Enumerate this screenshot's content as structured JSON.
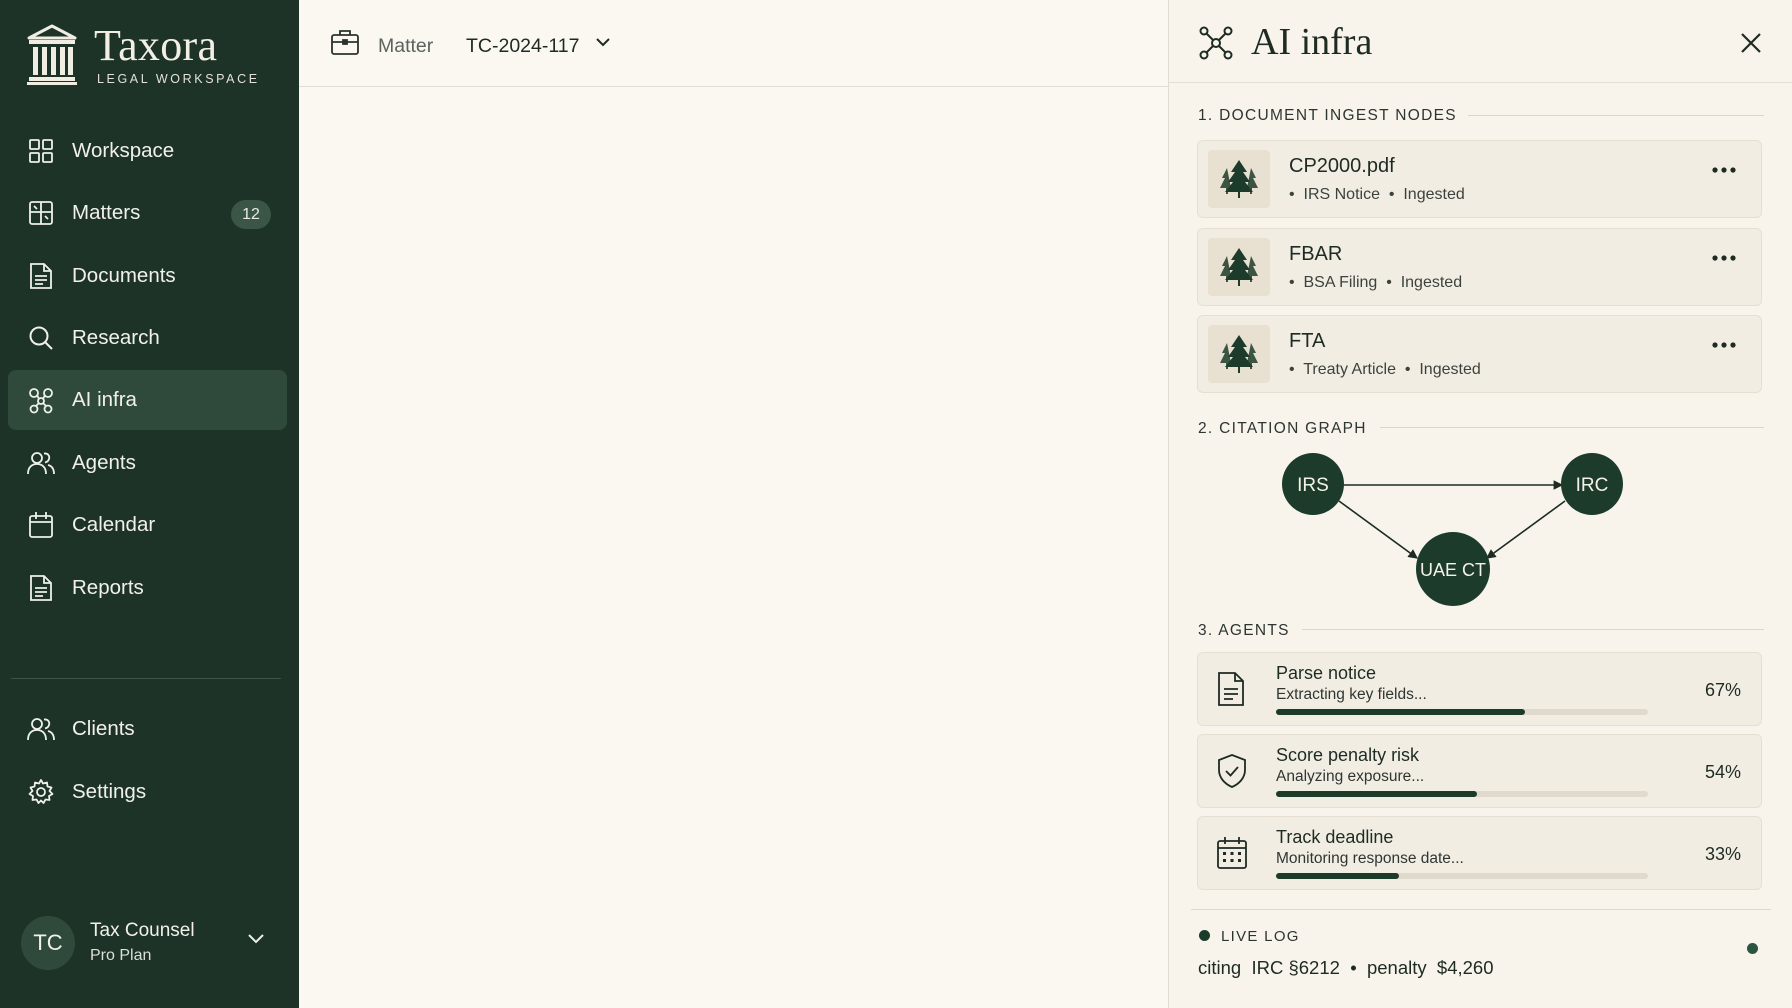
{
  "brand": {
    "name": "Taxora",
    "subtitle": "LEGAL WORKSPACE"
  },
  "sidebar": {
    "items": [
      {
        "label": "Workspace",
        "icon": "grid-icon"
      },
      {
        "label": "Matters",
        "icon": "book-icon",
        "badge": "12"
      },
      {
        "label": "Documents",
        "icon": "document-icon"
      },
      {
        "label": "Research",
        "icon": "search-icon"
      },
      {
        "label": "AI infra",
        "icon": "network-icon",
        "active": true
      },
      {
        "label": "Agents",
        "icon": "users-icon"
      },
      {
        "label": "Calendar",
        "icon": "calendar-icon"
      },
      {
        "label": "Reports",
        "icon": "report-icon"
      }
    ],
    "bottom_items": [
      {
        "label": "Clients",
        "icon": "users-icon"
      },
      {
        "label": "Settings",
        "icon": "gear-icon"
      }
    ],
    "user": {
      "initials": "TC",
      "name": "Tax Counsel",
      "plan": "Pro Plan"
    }
  },
  "topbar": {
    "matter_label": "Matter",
    "matter_id": "TC-2024-117"
  },
  "panel": {
    "title": "AI infra",
    "sections": {
      "ingest": "1. DOCUMENT INGEST NODES",
      "graph": "2. CITATION GRAPH",
      "agents": "3. AGENTS"
    },
    "documents": [
      {
        "name": "CP2000.pdf",
        "type": "IRS Notice",
        "status": "Ingested"
      },
      {
        "name": "FBAR",
        "type": "BSA Filing",
        "status": "Ingested"
      },
      {
        "name": "FTA",
        "type": "Treaty Article",
        "status": "Ingested"
      }
    ],
    "graph_nodes": {
      "irs": "IRS",
      "irc": "IRC",
      "uae": "UAE CT"
    },
    "agents": [
      {
        "name": "Parse notice",
        "status": "Extracting key fields...",
        "progress": 67,
        "pct": "67%",
        "icon": "document-icon"
      },
      {
        "name": "Score penalty risk",
        "status": "Analyzing exposure...",
        "progress": 54,
        "pct": "54%",
        "icon": "shield-check-icon"
      },
      {
        "name": "Track deadline",
        "status": "Monitoring response date...",
        "progress": 33,
        "pct": "33%",
        "icon": "calendar-icon"
      }
    ],
    "live_log": {
      "title": "LIVE LOG",
      "prefix": "citing",
      "citation": "IRC §6212",
      "separator": "•",
      "penalty_label": "penalty",
      "penalty_value": "$4,260"
    }
  },
  "colors": {
    "sidebar_bg": "#1d3327",
    "accent": "#1d3b2b",
    "panel_bg": "#f8f4ec",
    "page_bg": "#fbf8f2"
  }
}
